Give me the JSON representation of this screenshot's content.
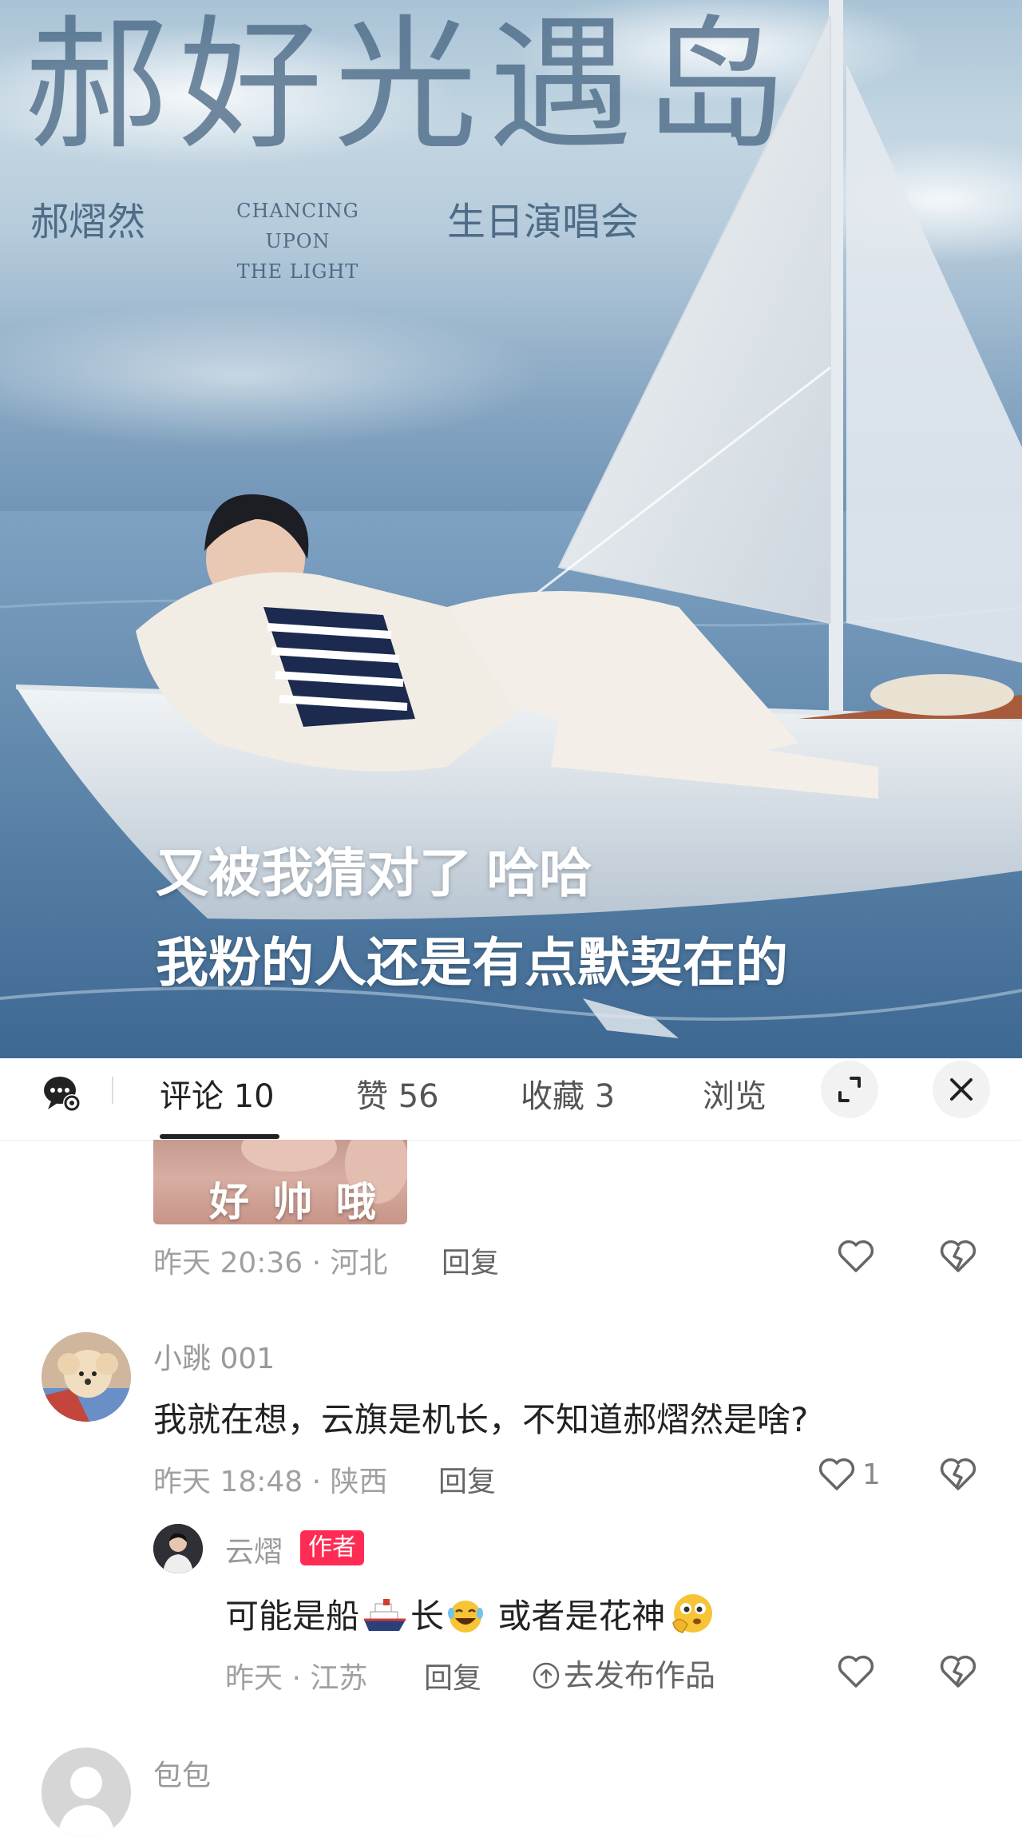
{
  "hero": {
    "title": "郝好光遇岛",
    "subtitle_left": "郝熠然",
    "subtitle_center_line1": "CHANCING UPON",
    "subtitle_center_line2": "THE LIGHT",
    "subtitle_right": "生日演唱会",
    "caption_line1": "又被我猜对了 哈哈",
    "caption_line2": "我粉的人还是有点默契在的"
  },
  "tabs": [
    {
      "label": "评论 10",
      "active": true
    },
    {
      "label": "赞 56",
      "active": false
    },
    {
      "label": "收藏 3",
      "active": false
    },
    {
      "label": "浏览",
      "active": false
    }
  ],
  "comments": {
    "c0": {
      "image_text": "好 帅 哦",
      "meta": "昨天 20:36 · 河北",
      "reply_label": "回复"
    },
    "c1": {
      "username": "小跳 001",
      "text": "我就在想，云旗是机长，不知道郝熠然是啥?",
      "meta": "昨天 18:48 · 陕西",
      "reply_label": "回复",
      "like_count": "1"
    },
    "c2": {
      "username": "云熠",
      "badge": "作者",
      "text_part1": "可能是船",
      "text_part2": "长",
      "text_part3": " 或者是花神",
      "meta": "昨天 · 江苏",
      "reply_label": "回复",
      "publish_label": "去发布作品"
    },
    "c3": {
      "username": "包包"
    }
  },
  "colors": {
    "accent_badge": "#fe2c55",
    "text_primary": "#222222",
    "text_meta": "#a0a0a0"
  },
  "icons": [
    "comment-settings-icon",
    "expand-icon",
    "close-icon",
    "heart-icon",
    "broken-heart-icon",
    "arrow-up-circle-icon"
  ]
}
